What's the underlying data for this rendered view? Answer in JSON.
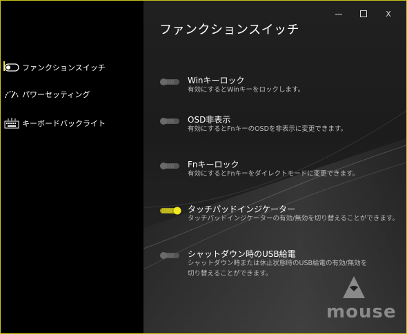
{
  "window": {
    "title": "ファンクションスイッチ",
    "controls": {
      "minimize": "minimize",
      "maximize": "maximize",
      "close": "X"
    }
  },
  "sidebar": {
    "items": [
      {
        "label": "ファンクションスイッチ",
        "icon": "toggle-icon",
        "active": true
      },
      {
        "label": "パワーセッティング",
        "icon": "gauge-icon",
        "active": false
      },
      {
        "label": "キーボードバックライト",
        "icon": "keyboard-icon",
        "active": false
      }
    ]
  },
  "options": [
    {
      "label": "Winキーロック",
      "desc": "有効にするとWinキーをロックします。",
      "desc2": "",
      "enabled": false
    },
    {
      "label": "OSD非表示",
      "desc": "有効にするとFnキーのOSDを非表示に変更できます。",
      "desc2": "",
      "enabled": false
    },
    {
      "label": "Fnキーロック",
      "desc": "有効にするとFnキーをダイレクトモードに変更できます。",
      "desc2": "",
      "enabled": false
    },
    {
      "label": "タッチパッドインジケーター",
      "desc": "タッチパッドインジケーターの有効/無効を切り替えることができます。",
      "desc2": "",
      "enabled": true
    },
    {
      "label": "シャットダウン時のUSB給電",
      "desc": "シャットダウン時または休止状態時のUSB給電の有効/無効を",
      "desc2": "切り替えることができます。",
      "enabled": false
    }
  ],
  "brand": {
    "logo_text": "mouse"
  },
  "colors": {
    "accent": "#e8e02a",
    "border": "#c9c21a"
  }
}
